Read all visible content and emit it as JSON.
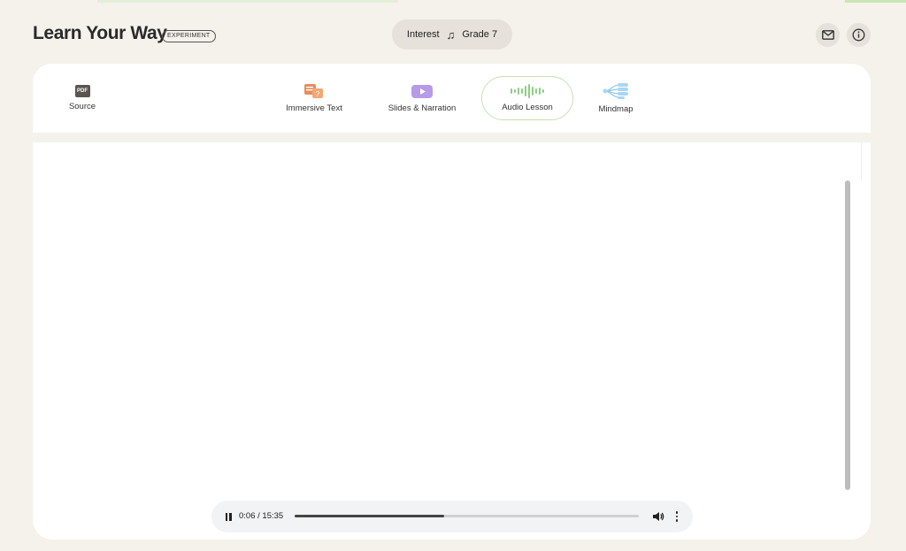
{
  "header": {
    "app_title": "Learn Your Way",
    "badge": "EXPERIMENT",
    "prefs": {
      "interest_label": "Interest",
      "interest_icon": "music-note-icon",
      "grade_label": "Grade 7"
    },
    "actions": [
      {
        "icon": "mail-icon"
      },
      {
        "icon": "info-icon"
      }
    ]
  },
  "tabs": [
    {
      "label": "Source",
      "icon": "pdf-icon",
      "active": false
    },
    {
      "label": "Immersive Text",
      "icon": "immersive-text-icon",
      "active": false
    },
    {
      "label": "Slides & Narration",
      "icon": "slides-play-icon",
      "active": false
    },
    {
      "label": "Audio Lesson",
      "icon": "audio-wave-icon",
      "active": true
    },
    {
      "label": "Mindmap",
      "icon": "mindmap-icon",
      "active": false
    }
  ],
  "source_icon_text": "PDF",
  "player": {
    "state": "playing",
    "time": "0:06 / 15:35",
    "progress": 0.435
  },
  "colors": {
    "background": "#f5f1eb",
    "active_tab_border": "#c8e0b6",
    "audio_wave": "#8ccf83",
    "immersive_icon": "#e88d5c",
    "slides_icon": "#b79ae8",
    "mindmap_icon": "#8fc7ea"
  }
}
